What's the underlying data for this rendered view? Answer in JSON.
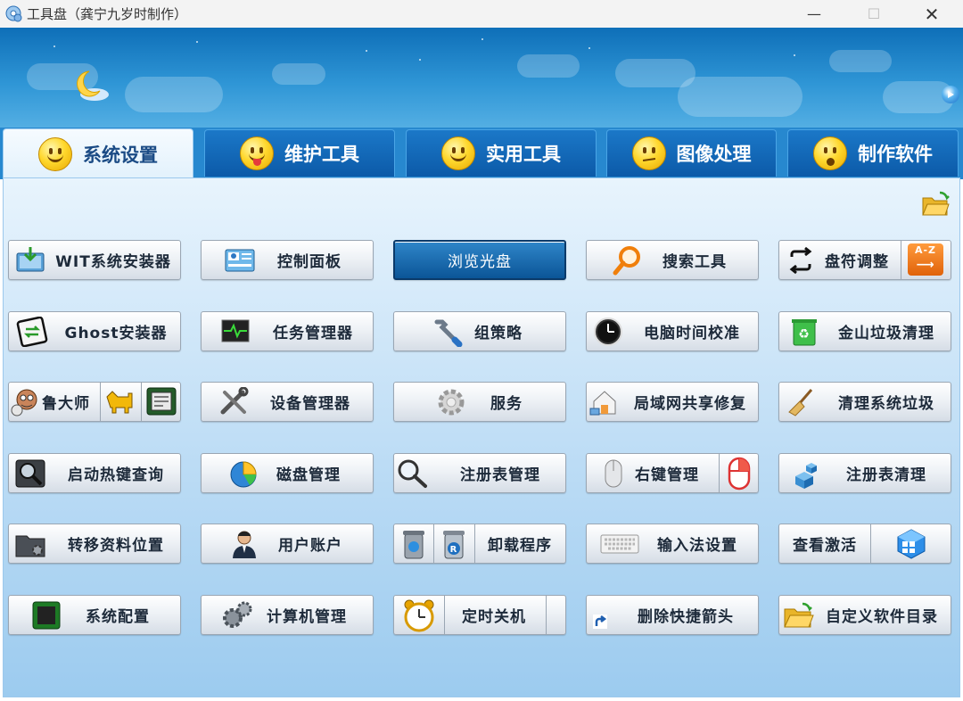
{
  "window": {
    "title": "工具盘（龚宁九岁时制作）",
    "min": "—",
    "max": "☐",
    "close": "✕"
  },
  "tabs": [
    {
      "label": "系统设置",
      "active": true
    },
    {
      "label": "维护工具",
      "active": false
    },
    {
      "label": "实用工具",
      "active": false
    },
    {
      "label": "图像处理",
      "active": false
    },
    {
      "label": "制作软件",
      "active": false
    }
  ],
  "buttons": {
    "wit_installer": "WIT系统安装器",
    "control_panel": "控制面板",
    "browse_disc": "浏览光盘",
    "search_tool": "搜索工具",
    "drive_letter": "盘符调整",
    "ghost_installer": "Ghost安装器",
    "task_manager": "任务管理器",
    "group_policy": "组策略",
    "time_sync": "电脑时间校准",
    "kingsoft_clean": "金山垃圾清理",
    "ludashi": "鲁大师",
    "device_manager": "设备管理器",
    "services": "服务",
    "lan_share_fix": "局域网共享修复",
    "clean_system_junk": "清理系统垃圾",
    "startup_hotkey": "启动热键查询",
    "disk_management": "磁盘管理",
    "registry_manager": "注册表管理",
    "context_menu": "右键管理",
    "registry_clean": "注册表清理",
    "move_profile": "转移资料位置",
    "user_accounts": "用户账户",
    "uninstall": "卸载程序",
    "ime_settings": "输入法设置",
    "check_activation": "查看激活",
    "sys_config": "系统配置",
    "computer_management": "计算机管理",
    "timed_shutdown": "定时关机",
    "remove_shortcut_arrow": "删除快捷箭头",
    "custom_software_dir": "自定义软件目录"
  },
  "az_badge": "A-Z",
  "colors": {
    "header": "#1478c4",
    "tab_active_bg": "#eef7fe",
    "content_bg": "#c8e3f8",
    "selected_button": "#0b5597"
  }
}
